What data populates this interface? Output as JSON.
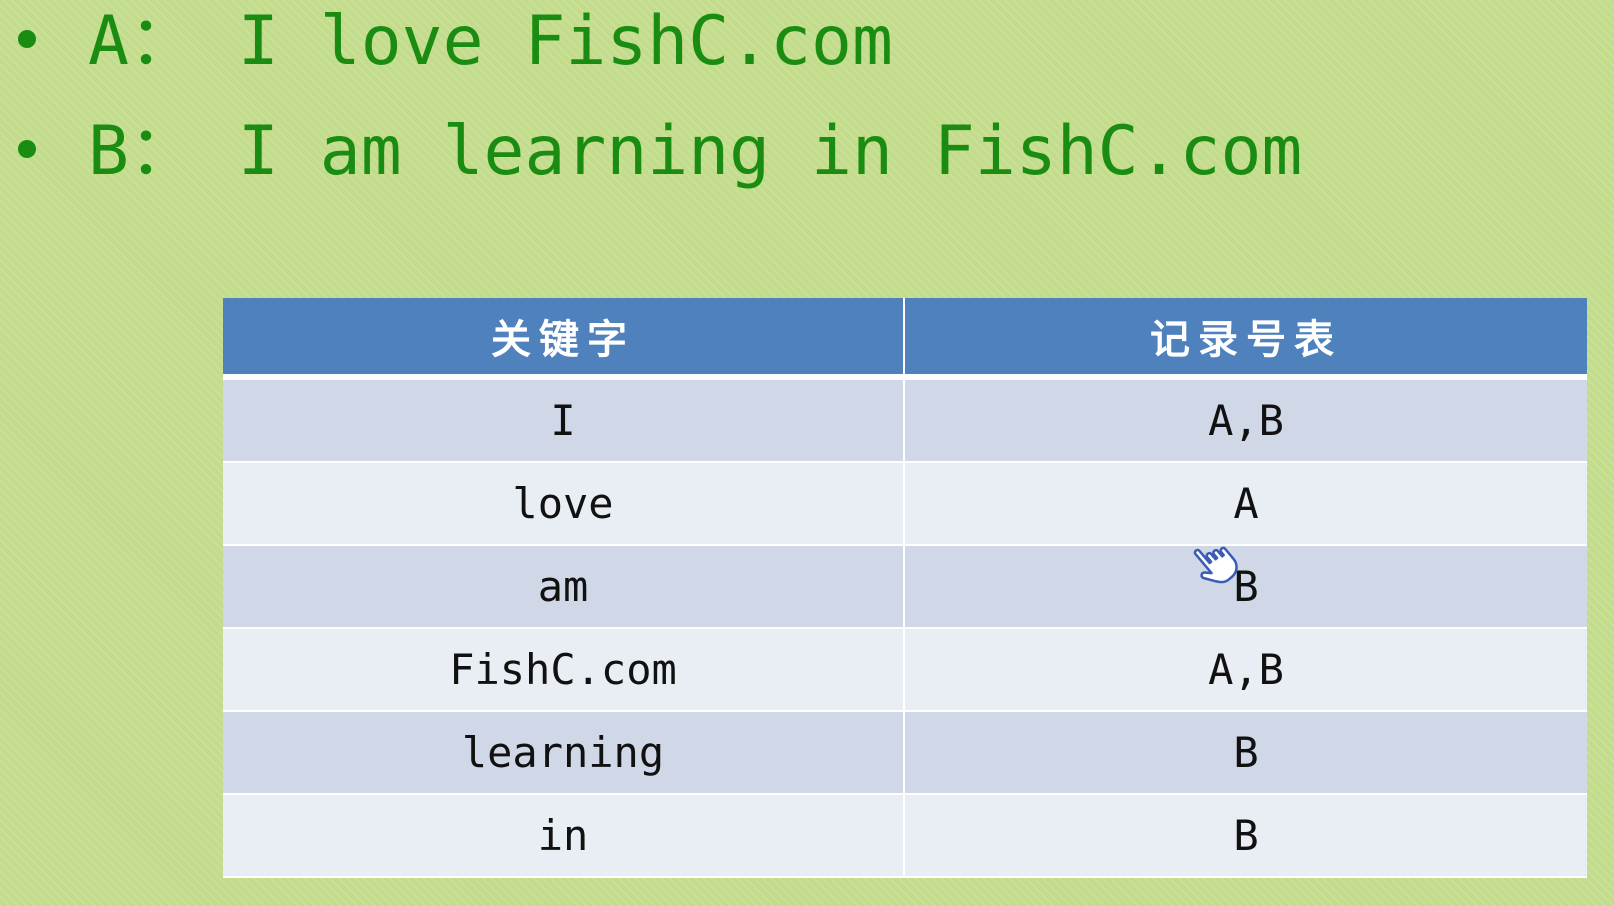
{
  "slide": {
    "bullets": [
      {
        "label": "A：",
        "text": "I love FishC.com"
      },
      {
        "label": "B：",
        "text": "I am learning in FishC.com"
      }
    ],
    "colors": {
      "background": "#c2dc8c",
      "bullet_text": "#1b8c12",
      "table_header": "#4f81bd",
      "row_odd": "#d0d8e8",
      "row_even": "#e9edf4"
    }
  },
  "table": {
    "headers": [
      "关键字",
      "记录号表"
    ],
    "rows": [
      [
        "I",
        "A,B"
      ],
      [
        "love",
        "A"
      ],
      [
        "am",
        "B"
      ],
      [
        "FishC.com",
        "A,B"
      ],
      [
        "learning",
        "B"
      ],
      [
        "in",
        "B"
      ]
    ]
  },
  "cursor": {
    "icon": "hand-pointer-icon"
  }
}
